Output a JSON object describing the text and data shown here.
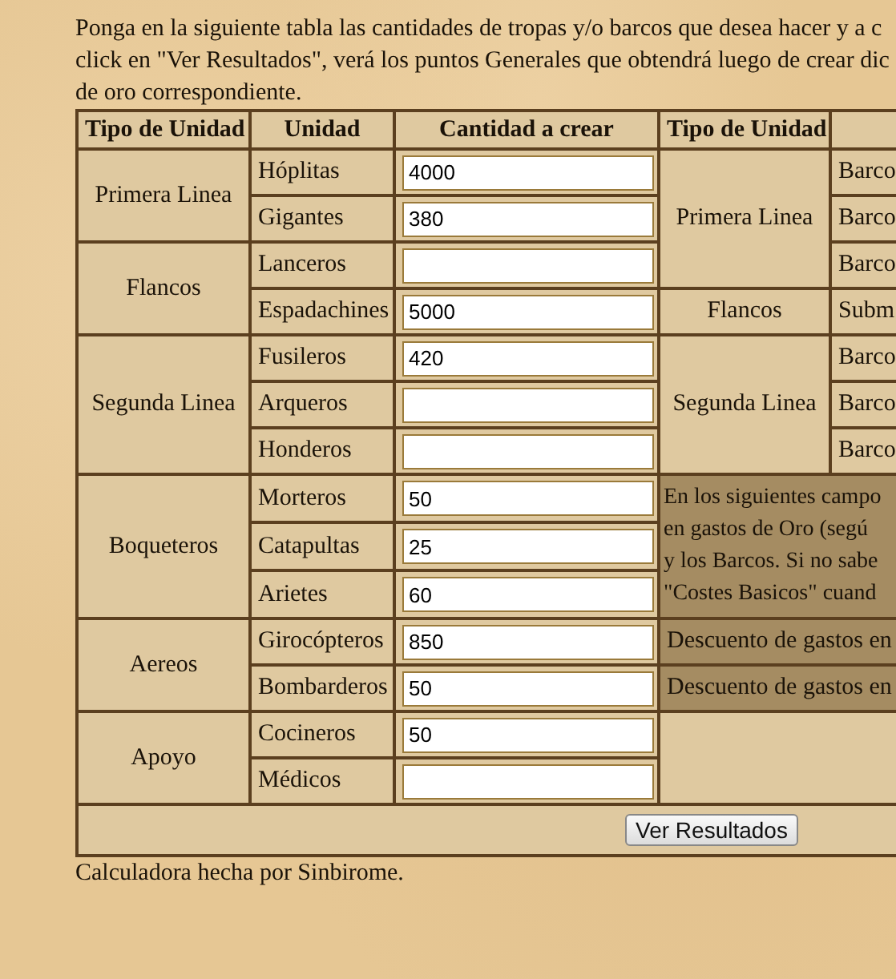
{
  "intro": [
    "Ponga en la siguiente tabla las cantidades de tropas y/o barcos que desea hacer y a c",
    "click en \"Ver Resultados\", verá los puntos Generales que obtendrá luego de crear dic",
    "de oro correspondiente."
  ],
  "table": {
    "columns": [
      "Tipo de Unidad",
      "Unidad",
      "Cantidad a crear",
      "Tipo de Unidad"
    ],
    "troops": [
      {
        "type": "Primera Linea",
        "units": [
          {
            "name": "Hóplitas",
            "value": "4000"
          },
          {
            "name": "Gigantes",
            "value": "380"
          }
        ]
      },
      {
        "type": "Flancos",
        "units": [
          {
            "name": "Lanceros"
          },
          {
            "name": "Espadachines",
            "value": "5000"
          }
        ]
      },
      {
        "type": "Segunda Linea",
        "units": [
          {
            "name": "Fusileros",
            "value": "420"
          },
          {
            "name": "Arqueros"
          },
          {
            "name": "Honderos"
          }
        ]
      },
      {
        "type": "Boqueteros",
        "units": [
          {
            "name": "Morteros",
            "value": "50"
          },
          {
            "name": "Catapultas",
            "value": "25"
          },
          {
            "name": "Arietes",
            "value": "60"
          }
        ]
      },
      {
        "type": "Aereos",
        "units": [
          {
            "name": "Girocópteros",
            "value": "850"
          },
          {
            "name": "Bombarderos",
            "value": "50"
          }
        ]
      },
      {
        "type": "Apoyo",
        "units": [
          {
            "name": "Cocineros",
            "value": "50"
          },
          {
            "name": "Médicos"
          }
        ]
      }
    ],
    "ships": [
      {
        "type": "Primera Linea",
        "units": [
          "Barco",
          "Barco",
          "Barco"
        ]
      },
      {
        "type": "Flancos",
        "units": [
          "Subm"
        ]
      },
      {
        "type": "Segunda Linea",
        "units": [
          "Barco",
          "Barco",
          "Barco"
        ]
      }
    ],
    "note": [
      "En los siguientes campo",
      "en gastos de Oro (segú",
      "y los Barcos. Si no sabe",
      "\"Costes Basicos\" cuand"
    ],
    "discounts": [
      "Descuento de gastos en",
      "Descuento de gastos en"
    ]
  },
  "button": "Ver Resultados",
  "footer": "Calculadora hecha por Sinbirome."
}
